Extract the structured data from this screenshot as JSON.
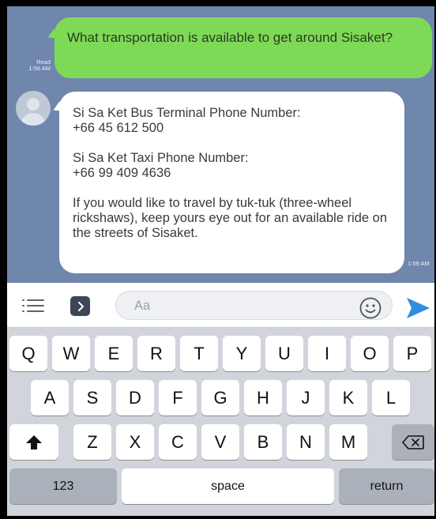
{
  "chat": {
    "outgoing": {
      "text": "What transportation is available to get around Sisaket?",
      "read_label": "Read",
      "time": "1:56 AM"
    },
    "incoming": {
      "paragraphs": [
        "Si Sa Ket Bus Terminal Phone Number:\n+66 45 612 500",
        "Si Sa Ket Taxi Phone Number:\n+66 99 409 4636",
        "If you would like to travel by tuk-tuk (three-wheel rickshaws), keep yours eye out for an available ride on the streets of Sisaket."
      ],
      "time": "1:59 AM"
    }
  },
  "input_bar": {
    "placeholder": "Aa",
    "icons": [
      "menu-icon",
      "chevron-right-icon",
      "emoji-icon",
      "send-icon"
    ],
    "send_color": "#2f8de4"
  },
  "keyboard": {
    "row1": [
      "q",
      "w",
      "e",
      "r",
      "t",
      "y",
      "u",
      "i",
      "o",
      "p"
    ],
    "row2": [
      "a",
      "s",
      "d",
      "f",
      "g",
      "h",
      "j",
      "k",
      "l"
    ],
    "row3": [
      "z",
      "x",
      "c",
      "v",
      "b",
      "n",
      "m"
    ],
    "numbers_label": "123",
    "space_label": "space",
    "return_label": "return"
  },
  "colors": {
    "chat_background": "#6f86ad",
    "outgoing_bubble": "#7ed957",
    "incoming_bubble": "#ffffff",
    "keyboard_background": "#d1d5db"
  }
}
